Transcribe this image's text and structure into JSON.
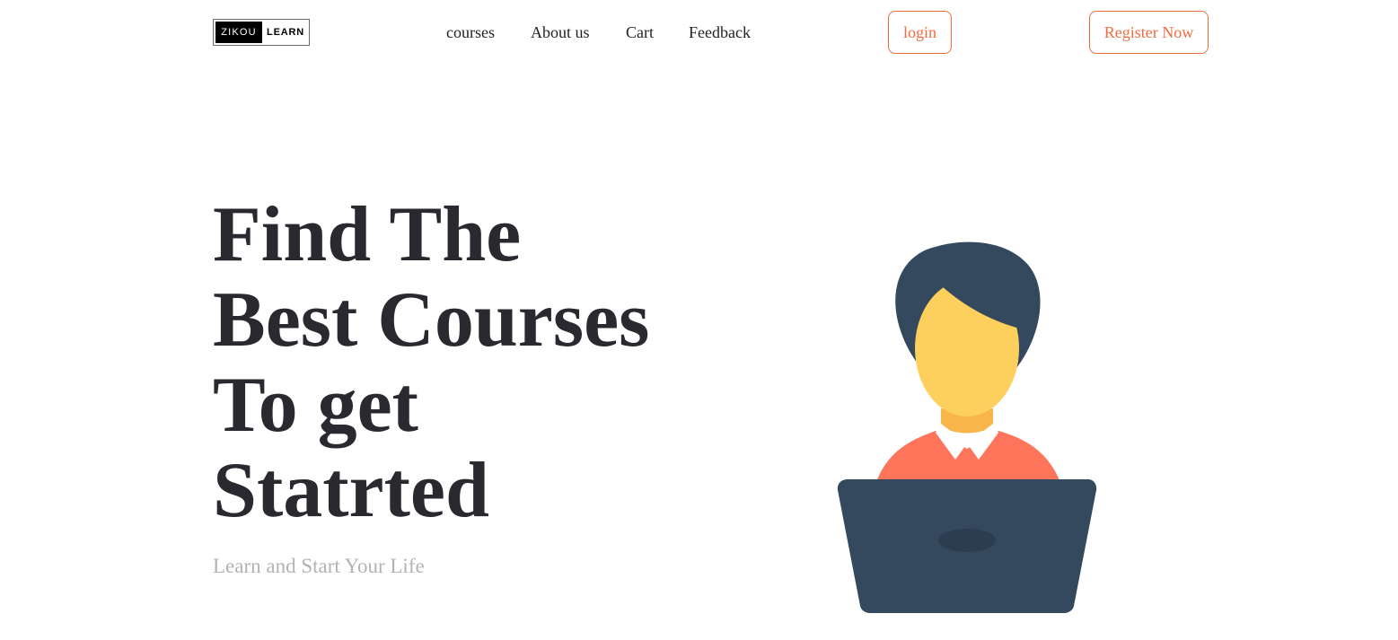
{
  "logo": {
    "part1": "ZIKOU",
    "part2": "LEARN"
  },
  "nav": {
    "items": [
      {
        "label": "courses"
      },
      {
        "label": "About us"
      },
      {
        "label": "Cart"
      },
      {
        "label": "Feedback"
      }
    ]
  },
  "auth": {
    "login_label": "login",
    "register_label": "Register Now"
  },
  "hero": {
    "title_lines": [
      "Find The",
      "Best Courses",
      "To get",
      "Statrted"
    ],
    "subtitle": "Learn and Start Your Life",
    "illustration_icon": "person-with-laptop-illustration"
  },
  "colors": {
    "accent": "#f26c3f",
    "heading": "#29292f",
    "subtitle": "#b3b3b3",
    "hair": "#34495e",
    "skin": "#fdcf5c",
    "neck": "#f7b54a",
    "shirt": "#fe755b",
    "laptop": "#34495e",
    "laptop_logo": "#2b3d4f"
  }
}
